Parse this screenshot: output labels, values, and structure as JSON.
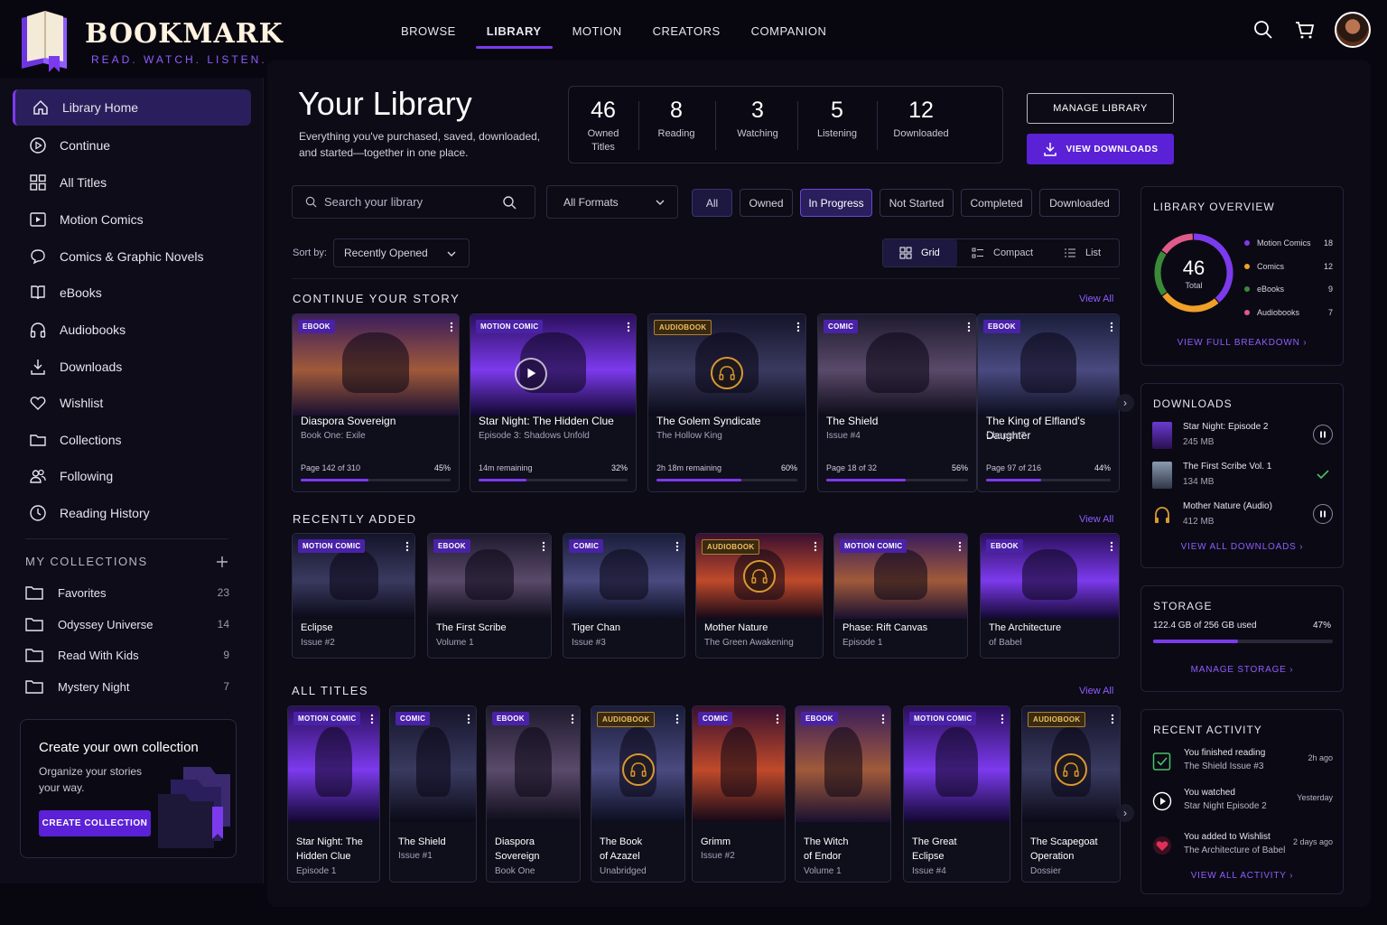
{
  "brand": {
    "name": "BOOKMARK",
    "tagline": "READ. WATCH. LISTEN."
  },
  "topnav": {
    "items": [
      "BROWSE",
      "LIBRARY",
      "MOTION",
      "CREATORS",
      "COMPANION"
    ],
    "active": "LIBRARY"
  },
  "header_icons": [
    "search-icon",
    "cart-icon"
  ],
  "sidebar": {
    "items": [
      {
        "label": "Library Home",
        "icon": "home-icon"
      },
      {
        "label": "Continue",
        "icon": "play-circle-icon"
      },
      {
        "label": "All Titles",
        "icon": "grid-icon"
      },
      {
        "label": "Motion Comics",
        "icon": "video-icon"
      },
      {
        "label": "Comics & Graphic Novels",
        "icon": "speech-bubble-icon"
      },
      {
        "label": "eBooks",
        "icon": "book-icon"
      },
      {
        "label": "Audiobooks",
        "icon": "headphones-icon"
      },
      {
        "label": "Downloads",
        "icon": "download-icon"
      },
      {
        "label": "Wishlist",
        "icon": "heart-icon"
      },
      {
        "label": "Collections",
        "icon": "folder-icon"
      },
      {
        "label": "Following",
        "icon": "users-icon"
      },
      {
        "label": "Reading History",
        "icon": "clock-icon"
      }
    ],
    "collections_heading": "MY COLLECTIONS",
    "collections": [
      {
        "label": "Favorites",
        "count": "23"
      },
      {
        "label": "Odyssey Universe",
        "count": "14"
      },
      {
        "label": "Read With Kids",
        "count": "9"
      },
      {
        "label": "Mystery Night",
        "count": "7"
      }
    ],
    "create": {
      "title": "Create your own collection",
      "subtitle": "Organize your stories your way.",
      "button": "CREATE COLLECTION"
    }
  },
  "library": {
    "title": "Your Library",
    "subtitle": "Everything you've purchased, saved, downloaded, and started—together in one place.",
    "stats": [
      {
        "num": "46",
        "label": "Owned Titles"
      },
      {
        "num": "8",
        "label": "Reading"
      },
      {
        "num": "3",
        "label": "Watching"
      },
      {
        "num": "5",
        "label": "Listening"
      },
      {
        "num": "12",
        "label": "Downloaded"
      }
    ],
    "manage_button": "MANAGE LIBRARY",
    "downloads_button": "VIEW DOWNLOADS"
  },
  "filters": {
    "search_placeholder": "Search your library",
    "format": "All Formats",
    "chips": [
      "All",
      "Owned",
      "In Progress",
      "Not Started",
      "Completed",
      "Downloaded"
    ],
    "sort_label": "Sort by:",
    "sort_value": "Recently Opened",
    "views": [
      "Grid",
      "Compact",
      "List"
    ]
  },
  "continue": {
    "heading": "CONTINUE YOUR STORY",
    "view_all": "View All",
    "cards": [
      {
        "badge": "EBOOK",
        "title": "Diaspora Sovereign",
        "sub": "Book One: Exile",
        "progress": "Page 142 of 310",
        "pct": "45%",
        "value": 0.45
      },
      {
        "badge": "MOTION COMIC",
        "title": "Star Night: The Hidden Clue",
        "sub": "Episode 3: Shadows Unfold",
        "progress": "14m remaining",
        "pct": "32%",
        "value": 0.32
      },
      {
        "badge": "AUDIOBOOK",
        "title": "The Golem Syndicate",
        "sub": "The Hollow King",
        "progress": "2h 18m remaining",
        "pct": "60%",
        "value": 0.6
      },
      {
        "badge": "COMIC",
        "title": "The Shield",
        "sub": "Issue #4",
        "progress": "Page 18 of 32",
        "pct": "56%",
        "value": 0.56
      },
      {
        "badge": "EBOOK",
        "title": "The King of Elfland's Daughter",
        "sub": "Chapter 7",
        "progress": "Page 97 of 216",
        "pct": "44%",
        "value": 0.44
      }
    ]
  },
  "recent": {
    "heading": "RECENTLY ADDED",
    "view_all": "View All",
    "cards": [
      {
        "badge": "MOTION COMIC",
        "title": "Eclipse",
        "sub": "Issue #2"
      },
      {
        "badge": "EBOOK",
        "title": "The First Scribe",
        "sub": "Volume 1"
      },
      {
        "badge": "COMIC",
        "title": "Tiger Chan",
        "sub": "Issue #3"
      },
      {
        "badge": "AUDIOBOOK",
        "title": "Mother Nature",
        "sub": "The Green Awakening"
      },
      {
        "badge": "MOTION COMIC",
        "title": "Phase: Rift Canvas",
        "sub": "Episode 1"
      },
      {
        "badge": "EBOOK",
        "title": "The Architecture",
        "sub": "of Babel"
      }
    ]
  },
  "all": {
    "heading": "ALL TITLES",
    "view_all": "View All",
    "cards": [
      {
        "badge": "MOTION COMIC",
        "t1": "Star Night: The",
        "t2": "Hidden Clue",
        "sub": "Episode 1"
      },
      {
        "badge": "COMIC",
        "t1": "The Shield",
        "t2": "",
        "sub": "Issue #1"
      },
      {
        "badge": "EBOOK",
        "t1": "Diaspora",
        "t2": "Sovereign",
        "sub": "Book One"
      },
      {
        "badge": "AUDIOBOOK",
        "t1": "The Book",
        "t2": "of Azazel",
        "sub": "Unabridged"
      },
      {
        "badge": "COMIC",
        "t1": "Grimm",
        "t2": "",
        "sub": "Issue #2"
      },
      {
        "badge": "EBOOK",
        "t1": "The Witch",
        "t2": "of Endor",
        "sub": "Volume 1"
      },
      {
        "badge": "MOTION COMIC",
        "t1": "The Great",
        "t2": "Eclipse",
        "sub": "Issue #4"
      },
      {
        "badge": "AUDIOBOOK",
        "t1": "The Scapegoat",
        "t2": "Operation",
        "sub": "Dossier"
      }
    ]
  },
  "overview": {
    "heading": "LIBRARY OVERVIEW",
    "total": "46",
    "total_label": "Total",
    "segments": [
      {
        "label": "Motion Comics",
        "value": 18,
        "color": "#7c3aed"
      },
      {
        "label": "Comics",
        "value": 12,
        "color": "#f0a028"
      },
      {
        "label": "eBooks",
        "value": 9,
        "color": "#3a8a3a"
      },
      {
        "label": "Audiobooks",
        "value": 7,
        "color": "#e05a8a"
      }
    ],
    "link": "VIEW FULL BREAKDOWN"
  },
  "downloads": {
    "heading": "DOWNLOADS",
    "items": [
      {
        "name": "Star Night: Episode 2",
        "size": "245 MB",
        "action": "pause-icon"
      },
      {
        "name": "The First Scribe Vol. 1",
        "size": "134 MB",
        "action": "check-icon"
      },
      {
        "name": "Mother Nature (Audio)",
        "size": "412 MB",
        "action": "pause-icon"
      }
    ],
    "link": "VIEW ALL DOWNLOADS"
  },
  "storage": {
    "heading": "STORAGE",
    "used": "122.4 GB of 256 GB used",
    "pct": "47%",
    "value": 0.47,
    "link": "MANAGE STORAGE"
  },
  "activity": {
    "heading": "RECENT ACTIVITY",
    "items": [
      {
        "t1": "You finished reading",
        "t2": "The Shield Issue #3",
        "time": "2h ago",
        "icon": "book-check-icon"
      },
      {
        "t1": "You watched",
        "t2": "Star Night Episode 2",
        "time": "Yesterday",
        "icon": "play-icon"
      },
      {
        "t1": "You added to Wishlist",
        "t2": "The Architecture of Babel",
        "time": "2 days ago",
        "icon": "heart-icon"
      }
    ],
    "link": "VIEW ALL ACTIVITY"
  },
  "colors": {
    "accent": "#7c3aed",
    "button": "#5b21d6",
    "audio": "#d89a30"
  }
}
